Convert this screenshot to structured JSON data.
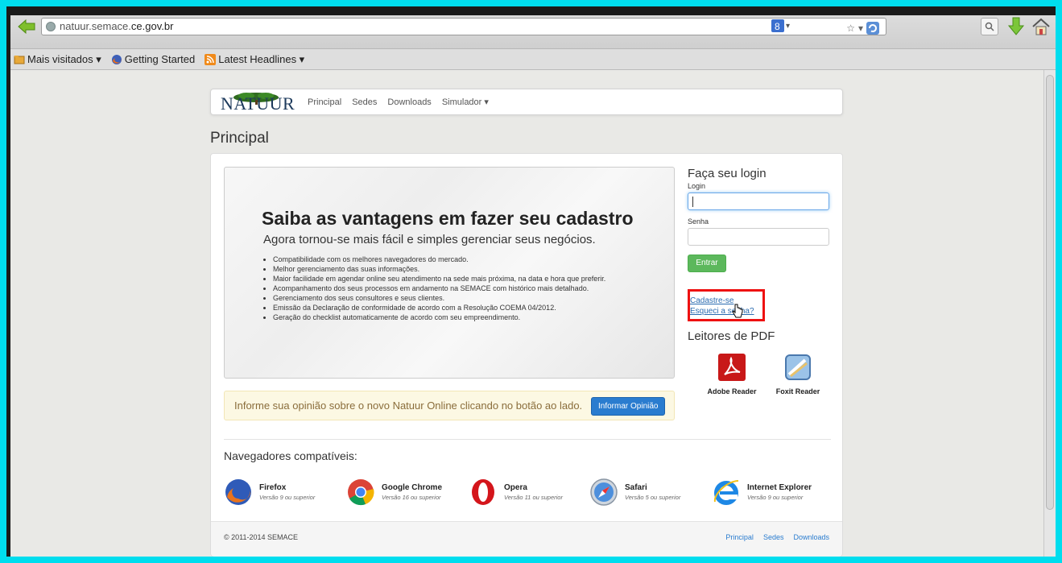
{
  "browser": {
    "url_prefix": "natuur.semace.",
    "url_host": "ce.gov.br",
    "bookmarks": [
      {
        "label": "Mais visitados ▾"
      },
      {
        "label": "Getting Started"
      },
      {
        "label": "Latest Headlines ▾"
      }
    ]
  },
  "nav": {
    "logo": "NATUUR",
    "links": [
      "Principal",
      "Sedes",
      "Downloads",
      "Simulador ▾"
    ]
  },
  "page_title": "Principal",
  "hero": {
    "title": "Saiba as vantagens em fazer seu cadastro",
    "subtitle": "Agora tornou-se mais fácil e simples gerenciar seus negócios.",
    "bullets": [
      "Compatibilidade com os melhores navegadores do mercado.",
      "Melhor gerenciamento das suas informações.",
      "Maior facilidade em agendar online seu atendimento na sede mais próxima, na data e hora que preferir.",
      "Acompanhamento dos seus processos em andamento na SEMACE com histórico mais detalhado.",
      "Gerenciamento dos seus consultores e seus clientes.",
      "Emissão da Declaração de conformidade de acordo com a Resolução COEMA 04/2012.",
      "Geração do checklist automaticamente de acordo com seu empreendimento."
    ]
  },
  "feedback": {
    "text": "Informe sua opinião sobre o novo Natuur Online clicando no botão ao lado.",
    "button": "Informar Opinião"
  },
  "login": {
    "title": "Faça seu login",
    "login_label": "Login",
    "login_value": "",
    "senha_label": "Senha",
    "senha_value": "",
    "submit": "Entrar",
    "register_link": "Cadastre-se",
    "forgot_link": "Esqueci a senha?"
  },
  "pdf": {
    "title": "Leitores de PDF",
    "readers": [
      "Adobe Reader",
      "Foxit Reader"
    ]
  },
  "browsers": {
    "title": "Navegadores compatíveis:",
    "items": [
      {
        "name": "Firefox",
        "version": "Versão 9 ou superior"
      },
      {
        "name": "Google Chrome",
        "version": "Versão 16 ou superior"
      },
      {
        "name": "Opera",
        "version": "Versão 11 ou superior"
      },
      {
        "name": "Safari",
        "version": "Versão 5 ou superior"
      },
      {
        "name": "Internet Explorer",
        "version": "Versão 9 ou superior"
      }
    ]
  },
  "footer": {
    "copyright": "© 2011-2014 SEMACE",
    "links": [
      "Principal",
      "Sedes",
      "Downloads"
    ]
  },
  "colors": {
    "accent": "#2a7ccf",
    "success": "#5cb85c",
    "highlight": "#ee1111",
    "outer_bg": "#00ddee"
  }
}
